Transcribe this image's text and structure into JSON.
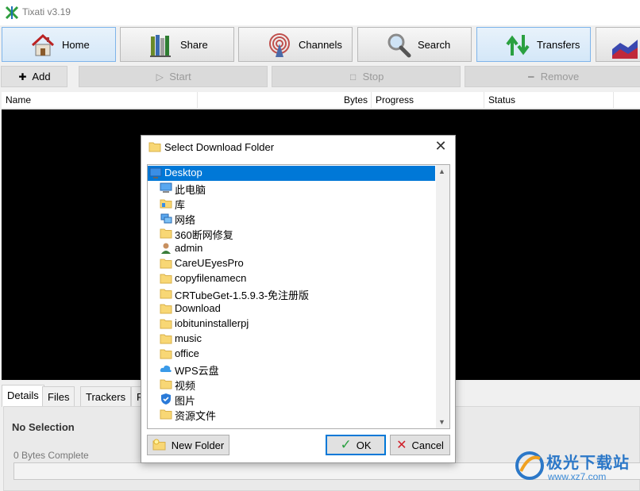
{
  "window": {
    "title": "Tixati v3.19"
  },
  "nav": [
    {
      "label": "Home",
      "icon": "house-icon"
    },
    {
      "label": "Share",
      "icon": "books-icon"
    },
    {
      "label": "Channels",
      "icon": "broadcast-icon"
    },
    {
      "label": "Search",
      "icon": "magnifier-icon"
    },
    {
      "label": "Transfers",
      "icon": "transfer-arrows-icon"
    }
  ],
  "toolbar": {
    "add": "Add",
    "start": "Start",
    "stop": "Stop",
    "remove": "Remove"
  },
  "columns": [
    "Name",
    "Bytes",
    "Progress",
    "Status"
  ],
  "tabs": [
    "Details",
    "Files",
    "Trackers",
    "P"
  ],
  "details": {
    "no_selection": "No Selection",
    "bytes_complete": "0 Bytes Complete"
  },
  "dialog": {
    "title": "Select Download Folder",
    "items": [
      {
        "label": "Desktop",
        "icon": "desktop-icon",
        "selected": true
      },
      {
        "label": "此电脑",
        "icon": "computer-icon"
      },
      {
        "label": "库",
        "icon": "library-icon"
      },
      {
        "label": "网络",
        "icon": "network-icon"
      },
      {
        "label": "360断网修复",
        "icon": "folder-icon"
      },
      {
        "label": "admin",
        "icon": "user-icon"
      },
      {
        "label": "CareUEyesPro",
        "icon": "folder-icon"
      },
      {
        "label": "copyfilenamecn",
        "icon": "folder-icon"
      },
      {
        "label": "CRTubeGet-1.5.9.3-免注册版",
        "icon": "folder-icon"
      },
      {
        "label": "Download",
        "icon": "folder-icon"
      },
      {
        "label": "iobituninstallerpj",
        "icon": "folder-icon"
      },
      {
        "label": "music",
        "icon": "folder-icon"
      },
      {
        "label": "office",
        "icon": "folder-icon"
      },
      {
        "label": "WPS云盘",
        "icon": "cloud-icon"
      },
      {
        "label": "视频",
        "icon": "folder-icon"
      },
      {
        "label": "图片",
        "icon": "shield-folder-icon"
      },
      {
        "label": "资源文件",
        "icon": "folder-icon"
      }
    ],
    "new_folder": "New Folder",
    "ok": "OK",
    "cancel": "Cancel"
  },
  "watermark": {
    "name": "极光下载站",
    "url": "www.xz7.com"
  },
  "colors": {
    "selection": "#0078d7",
    "list_bg": "#000000",
    "folder": "#f8d775"
  }
}
